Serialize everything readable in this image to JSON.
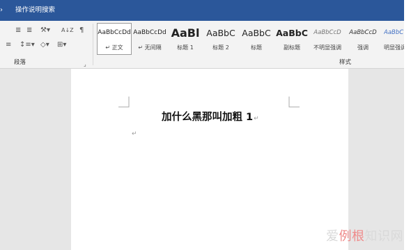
{
  "app": {
    "tell_me_placeholder": "操作说明搜索",
    "ui_accent": "#2b579a"
  },
  "ribbon": {
    "paragraph_group": {
      "label": "段落",
      "row1": [
        "≣",
        "≣",
        "⚒▾",
        "A↓Z",
        "¶"
      ],
      "row2": [
        "≡",
        "↕≡▾",
        "◇▾",
        "⊞▾"
      ]
    },
    "styles_group": {
      "label": "样式",
      "items": [
        {
          "preview": "AaBbCcDd",
          "name": "↵ 正文",
          "selected": true
        },
        {
          "preview": "AaBbCcDd",
          "name": "↵ 无间隔",
          "selected": false
        },
        {
          "preview": "AaBl",
          "name": "标题 1",
          "selected": false
        },
        {
          "preview": "AaBbC",
          "name": "标题 2",
          "selected": false
        },
        {
          "preview": "AaBbC",
          "name": "标题",
          "selected": false
        },
        {
          "preview": "AaBbC",
          "name": "副标题",
          "selected": false
        },
        {
          "preview": "AaBbCcD",
          "name": "不明显强调",
          "selected": false
        },
        {
          "preview": "AaBbCcD",
          "name": "强调",
          "selected": false
        },
        {
          "preview": "AaBbC",
          "name": "明显强调",
          "selected": false
        }
      ]
    }
  },
  "document": {
    "heading_text": "加什么黑那叫加粗 1",
    "paragraph_mark": "↵"
  },
  "watermark": {
    "prefix": "爱",
    "accent": "例根",
    "suffix": "知识网"
  }
}
